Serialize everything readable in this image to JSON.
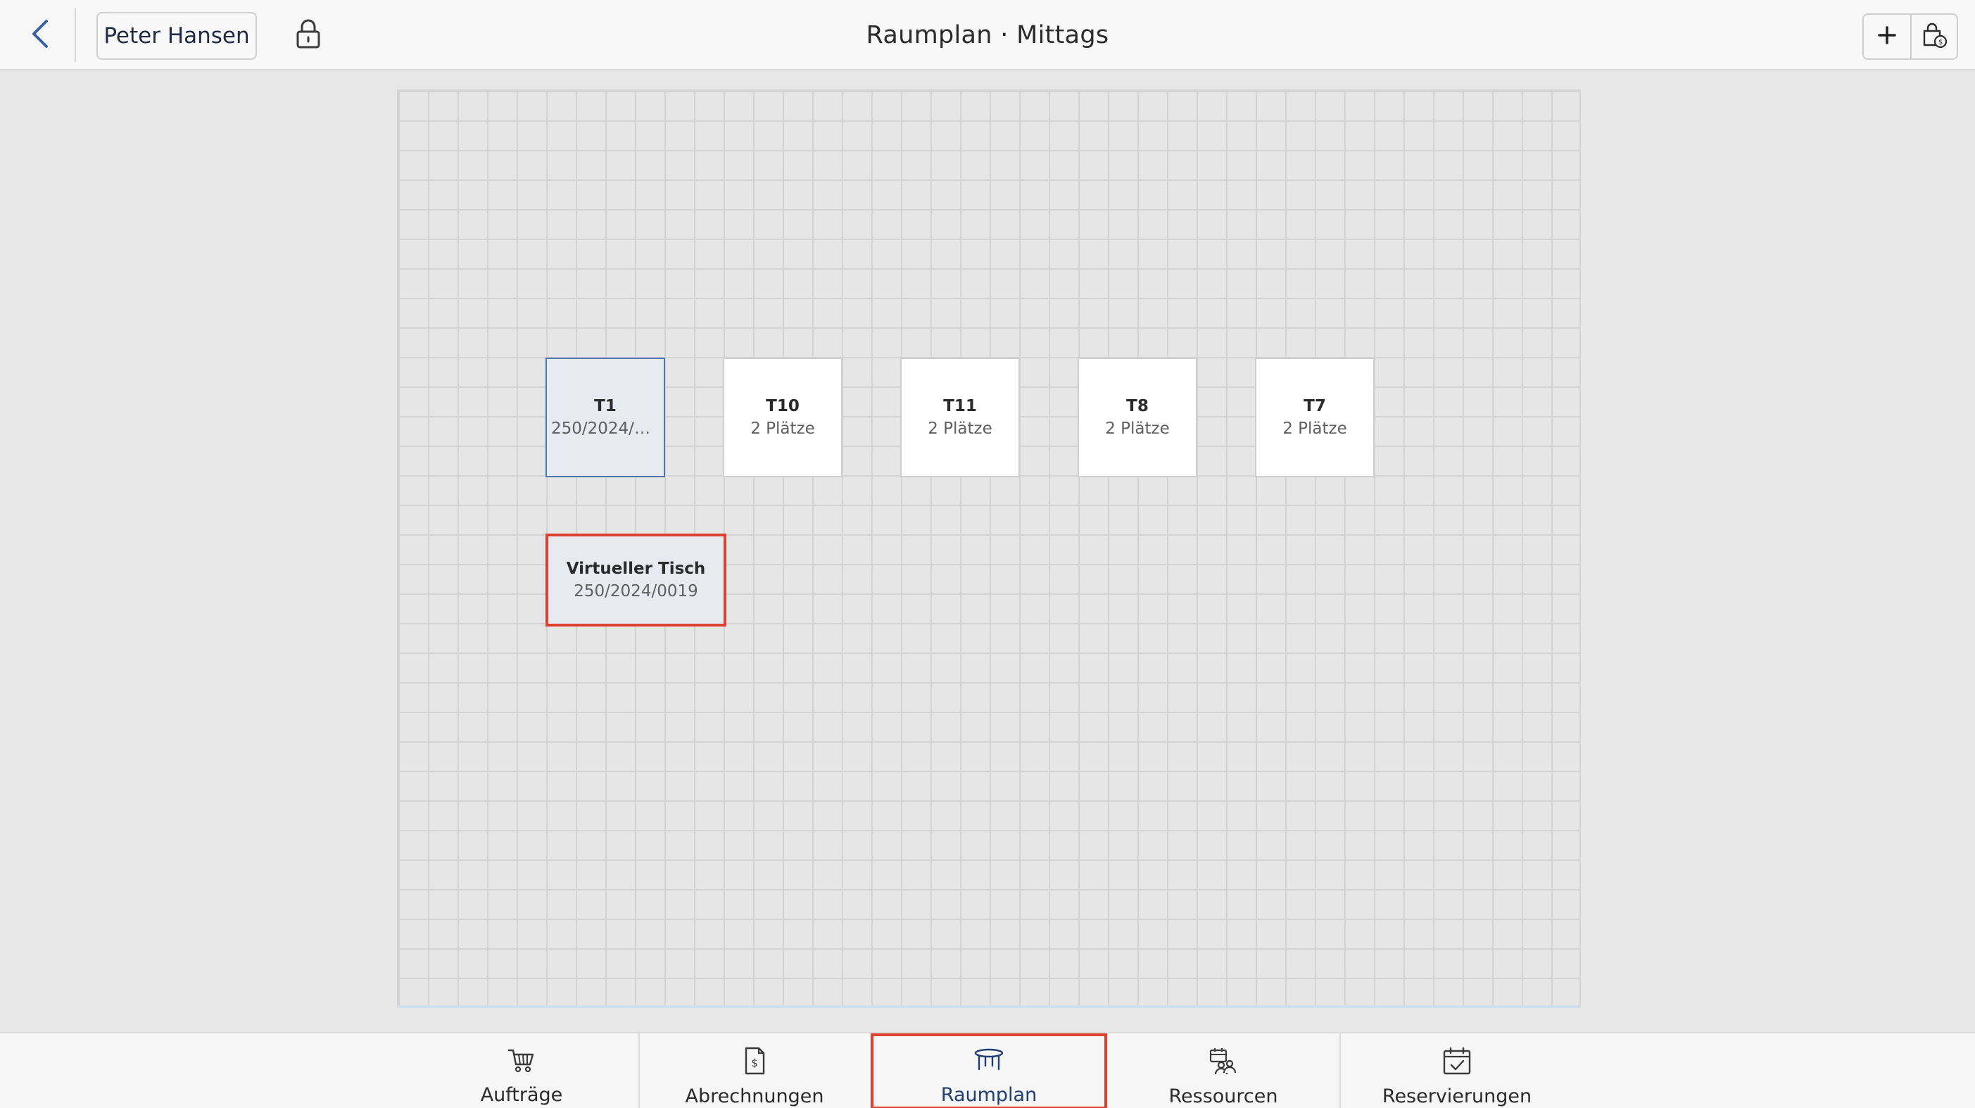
{
  "header": {
    "user_name": "Peter Hansen",
    "title": "Raumplan · Mittags"
  },
  "icons": {
    "back": "chevron-left-icon",
    "lock": "lock-icon",
    "add": "plus-icon",
    "bag": "shopping-bag-money-icon"
  },
  "colors": {
    "accent": "#1f3e72",
    "highlight": "#e0402c",
    "occupied_border": "#4d77b3"
  },
  "floor": {
    "tables": [
      {
        "name": "T1",
        "subtitle": "250/2024/0...",
        "status": "occupied"
      },
      {
        "name": "T10",
        "subtitle": "2 Plätze",
        "status": "free"
      },
      {
        "name": "T11",
        "subtitle": "2 Plätze",
        "status": "free"
      },
      {
        "name": "T8",
        "subtitle": "2 Plätze",
        "status": "free"
      },
      {
        "name": "T7",
        "subtitle": "2 Plätze",
        "status": "free"
      }
    ],
    "virtual_table": {
      "name": "Virtueller Tisch",
      "subtitle": "250/2024/0019"
    }
  },
  "tabs": [
    {
      "label": "Aufträge",
      "icon": "cart-icon",
      "active": false
    },
    {
      "label": "Abrechnungen",
      "icon": "invoice-icon",
      "active": false
    },
    {
      "label": "Raumplan",
      "icon": "table-icon",
      "active": true
    },
    {
      "label": "Ressourcen",
      "icon": "resources-icon",
      "active": false
    },
    {
      "label": "Reservierungen",
      "icon": "calendar-check-icon",
      "active": false
    }
  ]
}
